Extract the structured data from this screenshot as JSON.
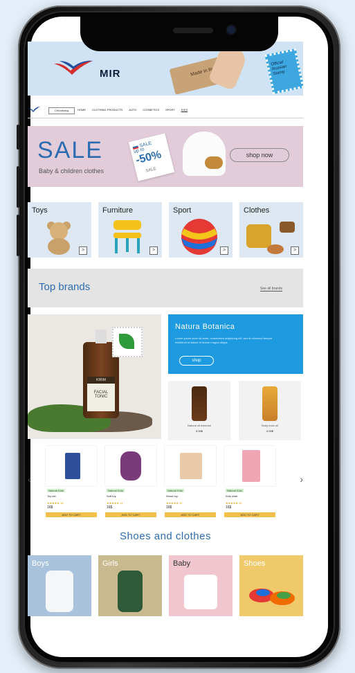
{
  "colors": {
    "accent_blue": "#2b6cb0",
    "background": "#e3eef8",
    "phone_frame": "#111111"
  },
  "hero": {
    "logo_text": "MIR",
    "parcel_text": "Made in Russia",
    "stamp_text": "Official Russian Stamp"
  },
  "nav": {
    "search_label": "Ctrl/catalog",
    "links": [
      "HOME",
      "CLOTHING PRODUCTS",
      "AUTO",
      "COSMETICS",
      "SPORT",
      "KIDS"
    ]
  },
  "sale_banner": {
    "title": "SALE",
    "subtitle": "Baby & children clothes",
    "tag_top": "SALE",
    "tag_upto": "up to",
    "tag_discount": "-50%",
    "tag_bottom": "SALE",
    "button": "shop now"
  },
  "categories": [
    {
      "label": "Toys",
      "icon": "teddy-bear-icon"
    },
    {
      "label": "Furniture",
      "icon": "chair-icon"
    },
    {
      "label": "Sport",
      "icon": "ball-icon"
    },
    {
      "label": "Clothes",
      "icon": "clothes-icon"
    }
  ],
  "category_arrow": ">",
  "top_brands": {
    "title": "Top brands",
    "link": "See all brands"
  },
  "promo": {
    "bottle_brand": "KIRIM",
    "bottle_product": "FACIAL TONIC",
    "natura_title": "Natura Botanica",
    "natura_desc": "Lorem ipsum dolor sit amet, consectetur adipiscing elit, sed do eiusmod tempor incididunt ut labore et dolore magna aliqua.",
    "natura_button": "shop"
  },
  "promo_products": [
    {
      "name": "Natural oil essence",
      "price": "0.00$"
    },
    {
      "name": "Body tonic oil",
      "price": "0.00$"
    }
  ],
  "carousel": {
    "prev": "‹",
    "next": "›",
    "items": [
      {
        "tag": "Natural Kids",
        "name": "Toy set",
        "stars": "★★★★★ 18",
        "price": "16$",
        "button": "ADD TO CART"
      },
      {
        "tag": "Natural Kids",
        "name": "Soft toy",
        "stars": "★★★★★ 14",
        "price": "16$",
        "button": "ADD TO CART"
      },
      {
        "tag": "Natural Kids",
        "name": "Wood toy",
        "stars": "★★★★★ 12",
        "price": "16$",
        "button": "ADD TO CART"
      },
      {
        "tag": "Natural Kids",
        "name": "Kids chair",
        "stars": "★★★★★ 20",
        "price": "16$",
        "button": "ADD TO CART"
      }
    ]
  },
  "shoes_clothes": {
    "title": "Shoes and clothes",
    "items": [
      {
        "label": "Boys",
        "bg": "#a9c3dd"
      },
      {
        "label": "Girls",
        "bg": "#c9b98f"
      },
      {
        "label": "Baby",
        "bg": "#f1c6cf"
      },
      {
        "label": "Shoes",
        "bg": "#f0c96a"
      }
    ]
  }
}
